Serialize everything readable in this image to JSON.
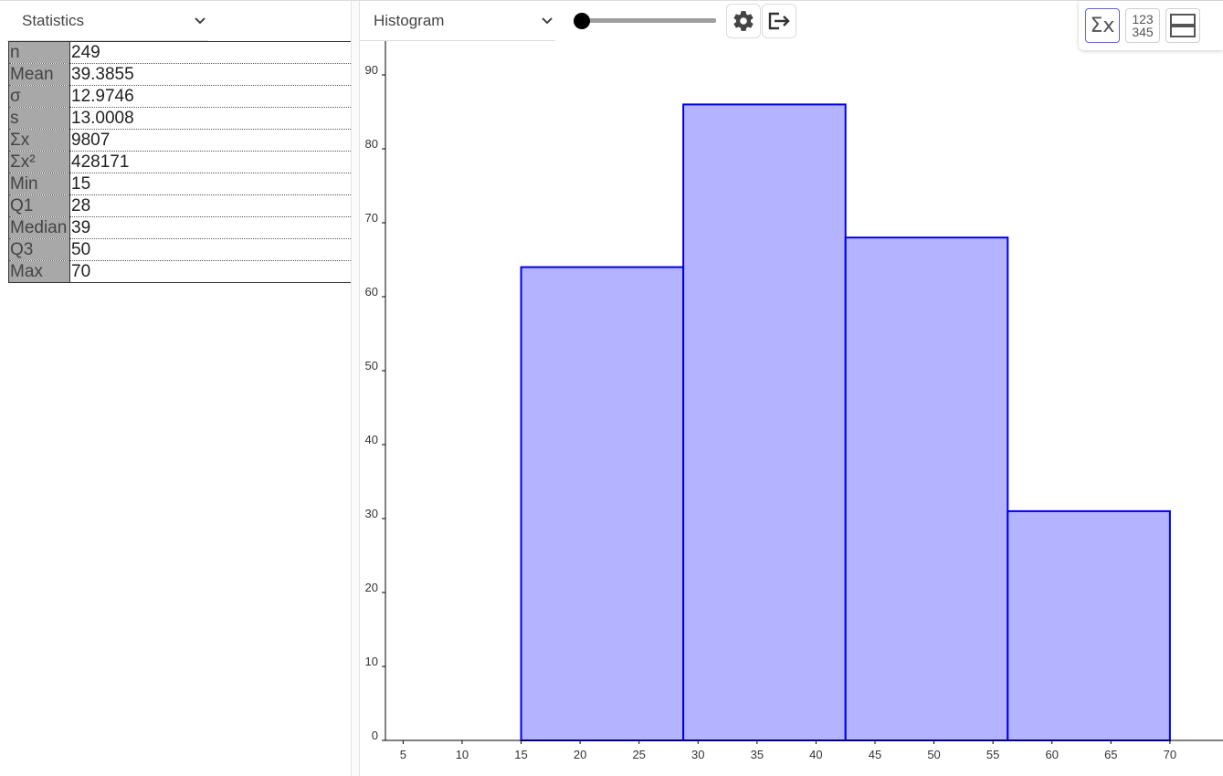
{
  "left_panel": {
    "dropdown_label": "Statistics",
    "rows": [
      {
        "label": "n",
        "value": "249"
      },
      {
        "label": "Mean",
        "value": "39.3855"
      },
      {
        "label": "σ",
        "value": "12.9746"
      },
      {
        "label": "s",
        "value": "13.0008"
      },
      {
        "label": "Σx",
        "value": "9807"
      },
      {
        "label": "Σx²",
        "value": "428171"
      },
      {
        "label": "Min",
        "value": "15"
      },
      {
        "label": "Q1",
        "value": "28"
      },
      {
        "label": "Median",
        "value": "39"
      },
      {
        "label": "Q3",
        "value": "50"
      },
      {
        "label": "Max",
        "value": "70"
      }
    ]
  },
  "toolbar": {
    "chart_type_label": "Histogram",
    "slider_level": 0.0,
    "settings_icon": "gear-icon",
    "export_icon": "export-icon"
  },
  "view_buttons": {
    "stats_icon": "sigma-icon",
    "stats_label": "Σx",
    "data_icon": "numbers-icon",
    "data_line1": "123",
    "data_line2": "345",
    "layout_icon": "layout-icon"
  },
  "chart_data": {
    "type": "bar",
    "title": "",
    "xlabel": "",
    "ylabel": "",
    "bins": [
      {
        "start": 15,
        "end": 28.75,
        "value": 64
      },
      {
        "start": 28.75,
        "end": 42.5,
        "value": 86
      },
      {
        "start": 42.5,
        "end": 56.25,
        "value": 68
      },
      {
        "start": 56.25,
        "end": 70,
        "value": 31
      }
    ],
    "xlim": [
      3.5,
      74.5
    ],
    "ylim": [
      0,
      95
    ],
    "xticks": [
      "5",
      "10",
      "15",
      "20",
      "25",
      "30",
      "35",
      "40",
      "45",
      "50",
      "55",
      "60",
      "65",
      "70"
    ],
    "yticks": [
      "0",
      "10",
      "20",
      "30",
      "40",
      "50",
      "60",
      "70",
      "80",
      "90"
    ],
    "bar_fill": "#b3b3ff",
    "bar_stroke": "#0000e6",
    "grid": false
  }
}
